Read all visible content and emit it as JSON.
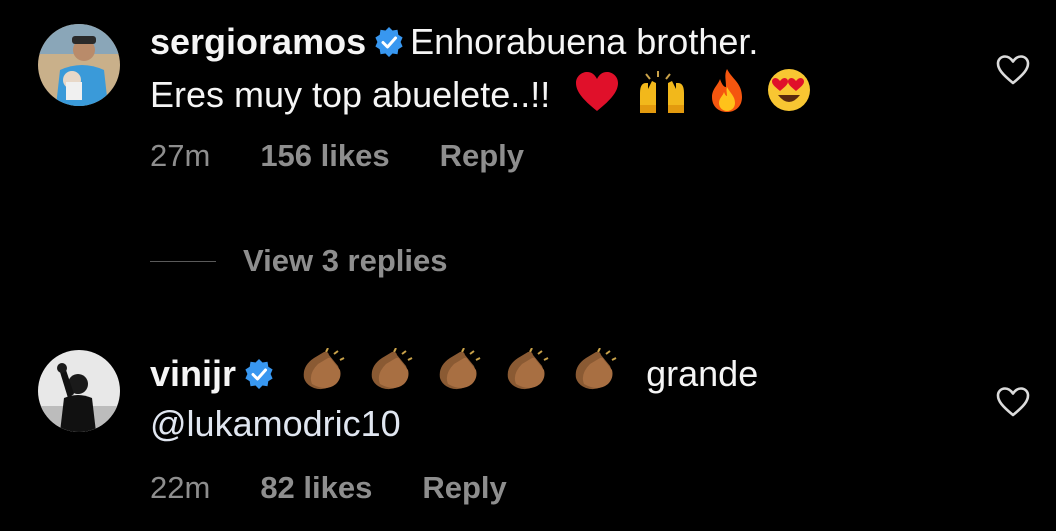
{
  "comments": [
    {
      "username": "sergioramos",
      "text_line1": "Enhorabuena brother.",
      "text_line2": "Eres muy top abuelete..!!",
      "emojis": [
        "red-heart",
        "raising-hands",
        "fire",
        "heart-eyes-face"
      ],
      "time": "27m",
      "likes": "156 likes",
      "reply": "Reply"
    },
    {
      "username": "vinijr",
      "emojis": [
        "clapping-hands",
        "clapping-hands",
        "clapping-hands",
        "clapping-hands",
        "clapping-hands"
      ],
      "text_line1": "grande",
      "mention": "@lukamodric10",
      "time": "22m",
      "likes": "82 likes",
      "reply": "Reply"
    }
  ],
  "view_replies": "View 3 replies",
  "colors": {
    "background": "#000000",
    "text": "#f5f5f5",
    "secondary": "#8e8e8e",
    "verified": "#3897f0"
  }
}
